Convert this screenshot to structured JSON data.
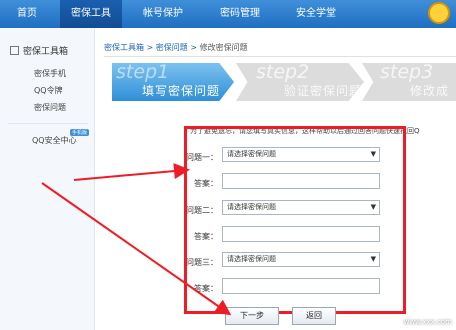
{
  "nav": {
    "tabs": [
      "首页",
      "密保工具",
      "帐号保护",
      "密码管理",
      "安全学堂"
    ]
  },
  "sidebar": {
    "title": "密保工具箱",
    "items": [
      "密保手机",
      "QQ令牌",
      "密保问题"
    ],
    "center": "QQ安全中心",
    "center_badge": "手机版"
  },
  "breadcrumb": [
    "密保工具箱",
    "密保问题",
    "修改密保问题"
  ],
  "steps": [
    {
      "big": "step1",
      "label": "填写密保问题"
    },
    {
      "big": "step2",
      "label": "验证密保问题"
    },
    {
      "big": "step3",
      "label": "修改成"
    }
  ],
  "form": {
    "notice": "为了避免遗忘，请您填写真实信息，这样帮助以后通过回答问题快速找回Q",
    "q1_label": "问题一：",
    "q2_label": "问题二：",
    "q3_label": "问题三：",
    "answer_label": "答案：",
    "select_placeholder": "请选择密保问题",
    "next_button": "下一步",
    "back_button": "返回"
  },
  "watermark": "www.xxx.com"
}
